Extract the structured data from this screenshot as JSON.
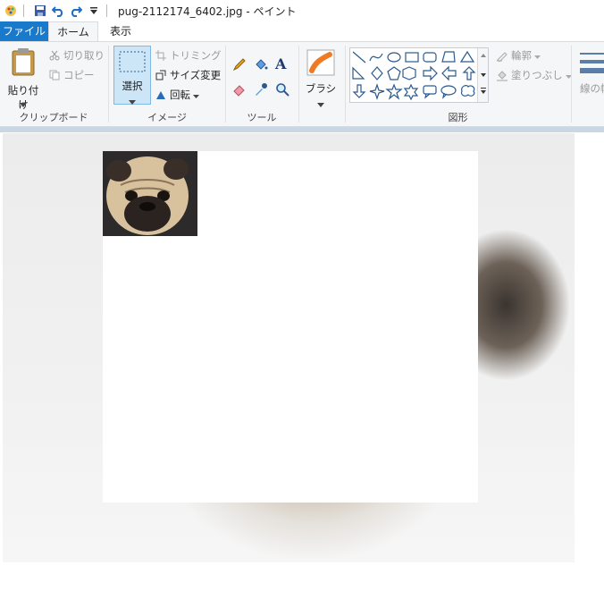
{
  "titlebar": {
    "title": "pug-2112174_6402.jpg - ペイント"
  },
  "tabs": {
    "file": "ファイル",
    "home": "ホーム",
    "view": "表示"
  },
  "clipboard": {
    "paste": "貼り付け",
    "cut": "切り取り",
    "copy": "コピー",
    "label": "クリップボード"
  },
  "image": {
    "select": "選択",
    "crop": "トリミング",
    "resize": "サイズ変更",
    "rotate": "回転",
    "label": "イメージ"
  },
  "tools": {
    "label": "ツール"
  },
  "brushes": {
    "label": "ブラシ"
  },
  "shapes": {
    "outline": "輪郭",
    "fill": "塗りつぶし",
    "label": "図形"
  },
  "size": {
    "label": "線の幅"
  },
  "colors": {
    "accent": "#1979ca",
    "ribbon_bg": "#f5f6f7",
    "select_highlight": "#cde6f7"
  }
}
